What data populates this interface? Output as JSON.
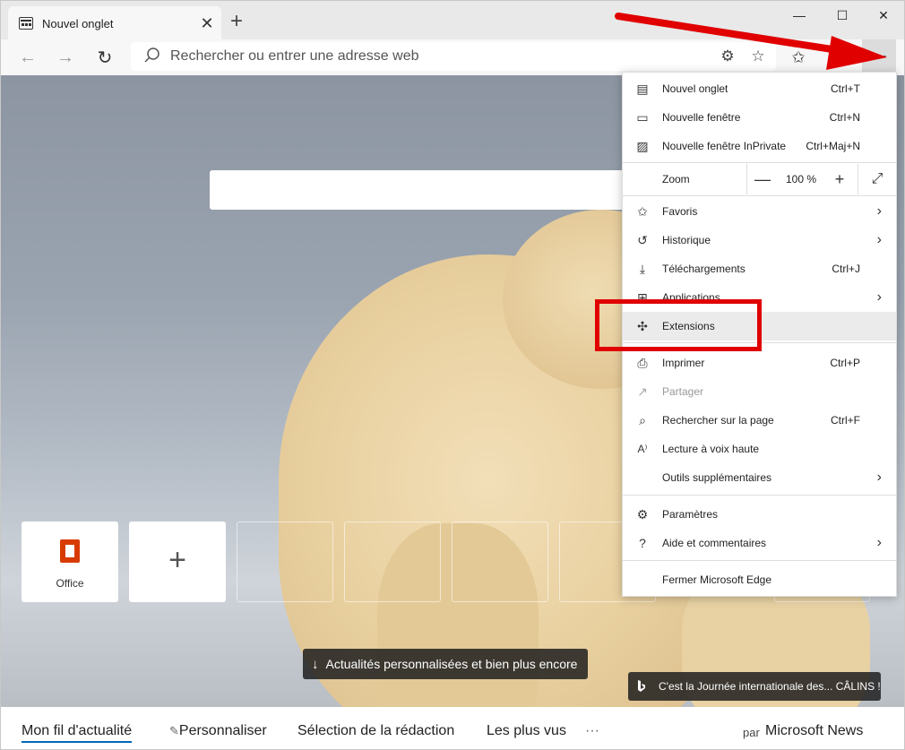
{
  "browser": {
    "tab_title": "Nouvel onglet",
    "address_placeholder": "Rechercher ou entrer une adresse web"
  },
  "menu": {
    "items_top": [
      {
        "label": "Nouvel onglet",
        "shortcut": "Ctrl+T",
        "icon": "new-tab-icon"
      },
      {
        "label": "Nouvelle fenêtre",
        "shortcut": "Ctrl+N",
        "icon": "new-window-icon"
      },
      {
        "label": "Nouvelle fenêtre InPrivate",
        "shortcut": "Ctrl+Maj+N",
        "icon": "inprivate-icon"
      }
    ],
    "zoom": {
      "label": "Zoom",
      "value": "100 %",
      "minus": "—",
      "plus": "+"
    },
    "items_mid": [
      {
        "label": "Favoris",
        "icon": "favorites-icon"
      },
      {
        "label": "Historique",
        "icon": "history-icon"
      },
      {
        "label": "Téléchargements",
        "shortcut": "Ctrl+J",
        "icon": "download-icon"
      },
      {
        "label": "Applications",
        "icon": "apps-icon"
      },
      {
        "label": "Extensions",
        "icon": "extensions-icon"
      }
    ],
    "items_low": [
      {
        "label": "Imprimer",
        "shortcut": "Ctrl+P",
        "icon": "print-icon"
      },
      {
        "label": "Partager",
        "icon": "share-icon"
      },
      {
        "label": "Rechercher sur la page",
        "shortcut": "Ctrl+F",
        "icon": "find-icon"
      },
      {
        "label": "Lecture à voix haute",
        "icon": "read-aloud-icon"
      },
      {
        "label": "Outils supplémentaires"
      }
    ],
    "items_bottom": [
      {
        "label": "Paramètres",
        "icon": "settings-icon"
      },
      {
        "label": "Aide et commentaires",
        "icon": "help-icon"
      }
    ],
    "close_label": "Fermer Microsoft Edge"
  },
  "tiles": {
    "office_label": "Office",
    "add_label": "+"
  },
  "news_button": "Actualités personnalisées et bien plus encore",
  "bing_caption": "C'est la Journée internationale des... CÂLINS !",
  "newsbar": {
    "feed": "Mon fil d'actualité",
    "customize": "Personnaliser",
    "editors": "Sélection de la rédaction",
    "most_viewed": "Les plus vus",
    "more": "···",
    "by": "par",
    "source": "Microsoft News"
  },
  "colors": {
    "highlight_red": "#e00000",
    "office_orange": "#d83b01",
    "active_blue": "#0067b8"
  }
}
